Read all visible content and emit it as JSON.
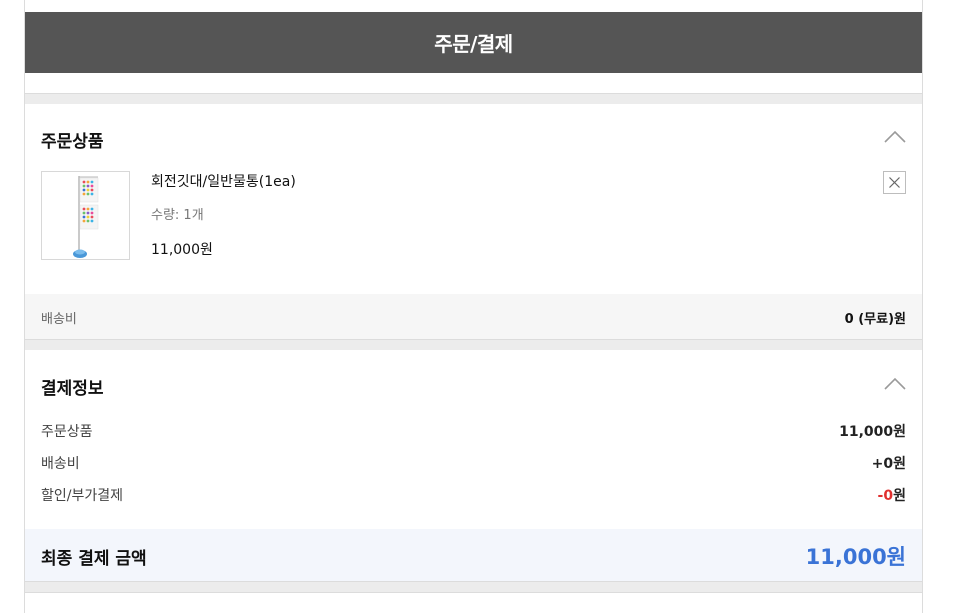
{
  "header": {
    "title": "주문/결제"
  },
  "order_section": {
    "title": "주문상품",
    "product": {
      "name": "회전깃대/일반물통(1ea)",
      "quantity_text": "수량: 1개",
      "price": "11,000원",
      "image_icon": "flag-banner-stand-image"
    },
    "shipping": {
      "label": "배송비",
      "value": "0 (무료)원"
    }
  },
  "payment_section": {
    "title": "결제정보",
    "rows": [
      {
        "label": "주문상품",
        "value": "11,000원"
      },
      {
        "label": "배송비",
        "value": "+0원"
      },
      {
        "label": "할인/부가결제",
        "value_prefix": "-0",
        "value_suffix": "원"
      }
    ],
    "final": {
      "label": "최종 결제 금액",
      "value": "11,000원"
    }
  },
  "colors": {
    "header_bg": "#555555",
    "accent_blue": "#3a73d6",
    "discount_red": "#e0302f"
  }
}
